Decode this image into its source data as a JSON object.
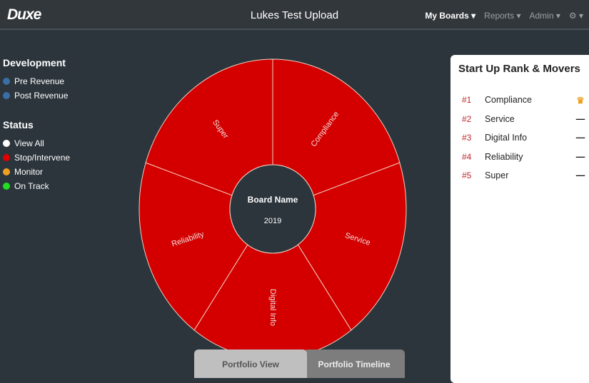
{
  "header": {
    "logo": "Duxe",
    "title": "Lukes Test Upload",
    "menu": [
      "My Boards",
      "Reports",
      "Admin"
    ],
    "gear": "gear-icon"
  },
  "development": {
    "title": "Development",
    "items": [
      {
        "label": "Pre Revenue",
        "color": "#3a6ea5"
      },
      {
        "label": "Post Revenue",
        "color": "#3a6ea5"
      }
    ]
  },
  "status": {
    "title": "Status",
    "items": [
      {
        "label": "View All",
        "color": "#ffffff"
      },
      {
        "label": "Stop/Intervene",
        "color": "#e00000"
      },
      {
        "label": "Monitor",
        "color": "#f0a020"
      },
      {
        "label": "On Track",
        "color": "#22dd22"
      }
    ]
  },
  "wheel": {
    "center_title": "Board Name",
    "center_sub": "2019",
    "color": "#d40000",
    "segments": [
      "Compliance",
      "Service",
      "Digital Info",
      "Reliability",
      "Super"
    ]
  },
  "rank": {
    "title": "Start Up Rank & Movers",
    "items": [
      {
        "rank": "#1",
        "name": "Compliance",
        "mover": "crown-icon"
      },
      {
        "rank": "#2",
        "name": "Service",
        "mover": "dash-icon"
      },
      {
        "rank": "#3",
        "name": "Digital Info",
        "mover": "dash-icon"
      },
      {
        "rank": "#4",
        "name": "Reliability",
        "mover": "dash-icon"
      },
      {
        "rank": "#5",
        "name": "Super",
        "mover": "dash-icon"
      }
    ]
  },
  "tabs": [
    "Portfolio View",
    "Portfolio Timeline"
  ]
}
